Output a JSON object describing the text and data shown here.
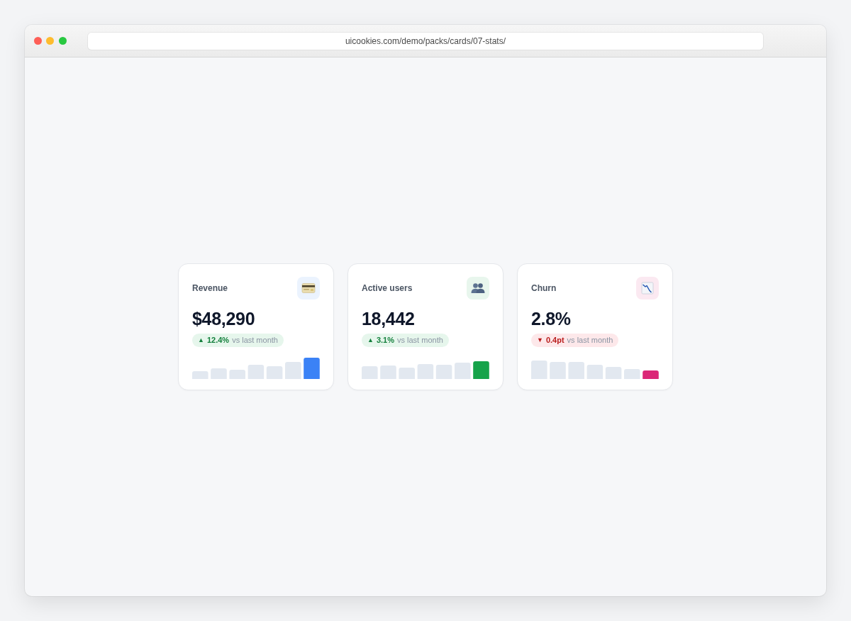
{
  "browser": {
    "url": "uicookies.com/demo/packs/cards/07-stats/"
  },
  "cards": [
    {
      "title": "Revenue",
      "value": "$48,290",
      "color": "#3b82f6",
      "change": {
        "kind": "up",
        "arrow": "▲",
        "amount": "12.4%",
        "note": "vs last month"
      }
    },
    {
      "title": "Active users",
      "value": "18,442",
      "color": "#16a34a",
      "change": {
        "kind": "up",
        "arrow": "▲",
        "amount": "3.1%",
        "note": "vs last month"
      }
    },
    {
      "title": "Churn",
      "value": "2.8%",
      "color": "#db2777",
      "change": {
        "kind": "down",
        "arrow": "▼",
        "amount": "0.4pt",
        "note": "vs last month"
      }
    }
  ]
}
